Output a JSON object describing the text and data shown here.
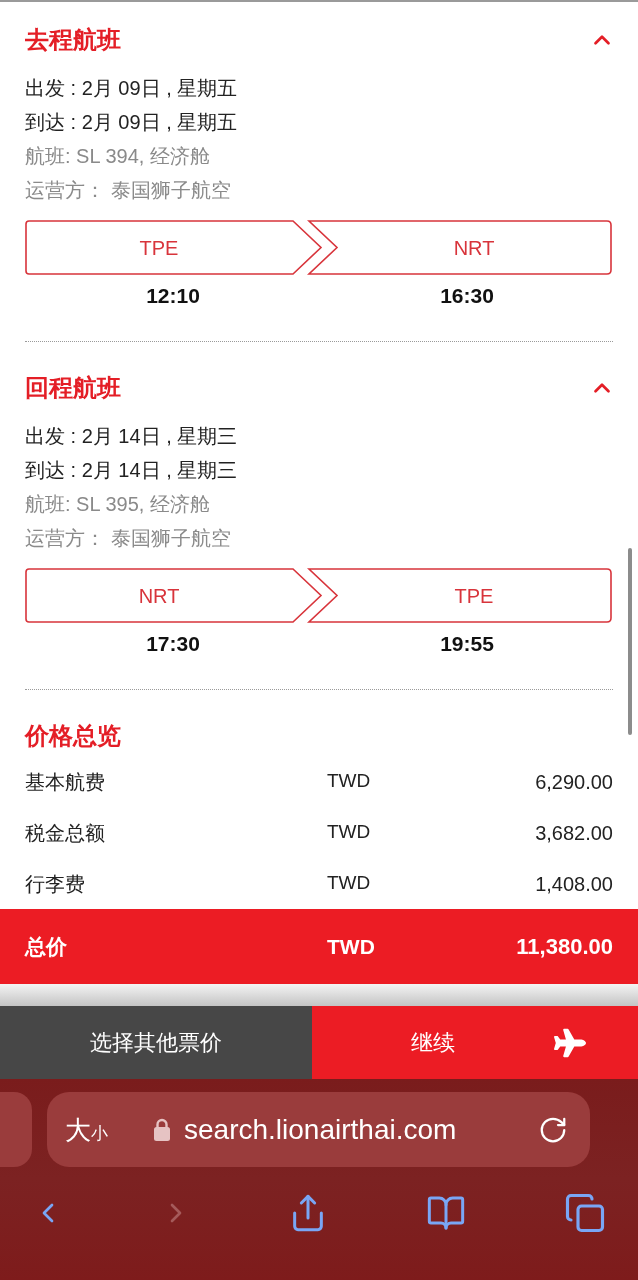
{
  "flights": [
    {
      "title": "去程航班",
      "expanded": true,
      "departure": "出发 : 2月 09日 , 星期五",
      "arrival": "到达 : 2月 09日 , 星期五",
      "flight": "航班: SL 394, 经济舱",
      "operator": "运营方： 泰国狮子航空",
      "origin": {
        "code": "TPE",
        "time": "12:10"
      },
      "destination": {
        "code": "NRT",
        "time": "16:30"
      }
    },
    {
      "title": "回程航班",
      "expanded": true,
      "departure": "出发 : 2月 14日 , 星期三",
      "arrival": "到达 : 2月 14日 , 星期三",
      "flight": "航班: SL 395, 经济舱",
      "operator": "运营方： 泰国狮子航空",
      "origin": {
        "code": "NRT",
        "time": "17:30"
      },
      "destination": {
        "code": "TPE",
        "time": "19:55"
      }
    }
  ],
  "price_overview": {
    "title": "价格总览",
    "rows": [
      {
        "label": "基本航费",
        "currency": "TWD",
        "amount": "6,290.00"
      },
      {
        "label": "税金总额",
        "currency": "TWD",
        "amount": "3,682.00"
      },
      {
        "label": "行李费",
        "currency": "TWD",
        "amount": "1,408.00"
      }
    ],
    "total": {
      "label": "总价",
      "currency": "TWD",
      "amount": "11,380.00"
    }
  },
  "actions": [
    {
      "label": "选择其他票价",
      "kind": "secondary"
    },
    {
      "label": "继续",
      "kind": "primary"
    }
  ],
  "browser": {
    "text_size": [
      "大",
      "小"
    ],
    "url": "search.lionairthai.com",
    "forward_button": {
      "disabled": true
    }
  }
}
